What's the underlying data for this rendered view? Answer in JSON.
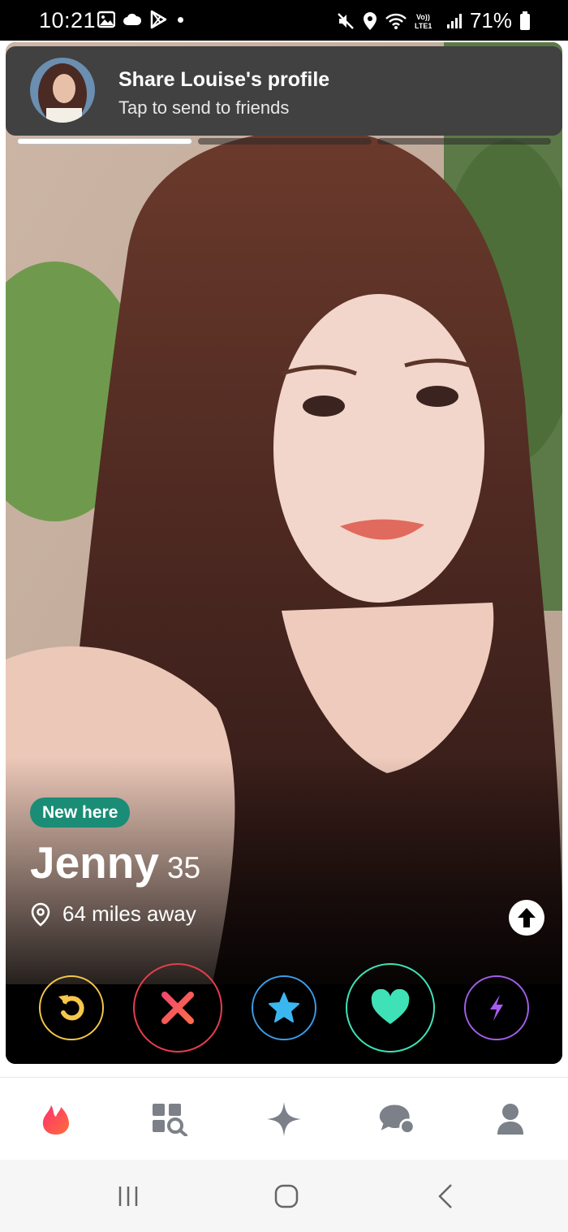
{
  "status_bar": {
    "time": "10:21",
    "battery": "71%",
    "icons": [
      "gallery-icon",
      "cloud-icon",
      "play-store-icon",
      "notification-dot",
      "mute-icon",
      "location-icon",
      "wifi-icon",
      "volte-lte-icon",
      "signal-icon",
      "battery-icon"
    ]
  },
  "banner": {
    "title": "Share Louise's profile",
    "subtitle": "Tap to send to friends"
  },
  "profile": {
    "photo_count": 3,
    "active_photo": 1,
    "badge": "New here",
    "name": "Jenny",
    "age": "35",
    "distance": "64 miles away"
  },
  "actions": [
    "rewind",
    "nope",
    "super-like",
    "like",
    "boost"
  ],
  "colors": {
    "rewind": "#f5c74a",
    "nope": "#e43e4c",
    "super_like": "#3a9ce6",
    "like": "#3fe2b6",
    "boost": "#a25ee8",
    "badge": "#1b8c75",
    "brand": "#fd4b5a"
  },
  "tabs": [
    "home-flame",
    "explore",
    "gold-likes",
    "messages",
    "profile"
  ],
  "system_nav": [
    "recents",
    "home",
    "back"
  ]
}
